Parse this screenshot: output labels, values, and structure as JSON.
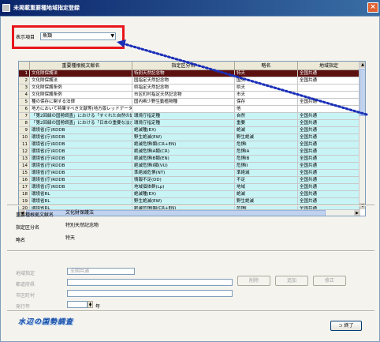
{
  "window": {
    "title": "未掲載重要種地域指定登録",
    "close_glyph": "×"
  },
  "filter": {
    "label": "表示項目",
    "value": "魚類",
    "arrow": "▼"
  },
  "grid": {
    "columns": [
      "",
      "重要種根拠文献名",
      "指定区分名",
      "略名",
      "地域指定"
    ],
    "rows": [
      {
        "n": "1",
        "doc": "文化財保護法",
        "cat": "特別天然記念物",
        "abbr": "特天",
        "region": "全国共通",
        "style": "selected"
      },
      {
        "n": "2",
        "doc": "文化財保護法",
        "cat": "国指定天然記念物",
        "abbr": "国天",
        "region": "全国共通",
        "style": "white"
      },
      {
        "n": "3",
        "doc": "文化財保護条例",
        "cat": "県指定天然記念物",
        "abbr": "県天",
        "region": "",
        "style": "white"
      },
      {
        "n": "4",
        "doc": "文化財保護条例",
        "cat": "市区町村指定天然記念物",
        "abbr": "市天",
        "region": "",
        "style": "white"
      },
      {
        "n": "5",
        "doc": "種の保存に関する法律",
        "cat": "国内希少野生動植物種",
        "abbr": "保存",
        "region": "全国共通",
        "style": "white"
      },
      {
        "n": "6",
        "doc": "地方において特筆すべき文献等(地方版レッドデータブック)",
        "cat": "",
        "abbr": "他",
        "region": "",
        "style": "white"
      },
      {
        "n": "7",
        "doc": "「第2回緑の国勢調査」における「すぐれた自然の調査」の対象",
        "cat": "環境庁指定種",
        "abbr": "自然",
        "region": "全国共通",
        "style": "cyan"
      },
      {
        "n": "8",
        "doc": "「第2回緑の国勢調査」における「日本の重要な淡水魚類」",
        "cat": "環境庁指定種",
        "abbr": "重要",
        "region": "全国共通",
        "style": "cyan"
      },
      {
        "n": "9",
        "doc": "環境省(庁)RDDB",
        "cat": "絶滅種(EX)",
        "abbr": "絶滅",
        "region": "全国共通",
        "style": "cyan"
      },
      {
        "n": "10",
        "doc": "環境省(庁)RDDB",
        "cat": "野生絶滅(EW)",
        "abbr": "野生絶滅",
        "region": "全国共通",
        "style": "cyan"
      },
      {
        "n": "11",
        "doc": "環境省(庁)RDDB",
        "cat": "絶滅危惧I類(CR+EN)",
        "abbr": "危惧I",
        "region": "全国共通",
        "style": "cyan"
      },
      {
        "n": "12",
        "doc": "環境省(庁)RDDB",
        "cat": "絶滅危惧IA類(CR)",
        "abbr": "危惧IA",
        "region": "全国共通",
        "style": "cyan"
      },
      {
        "n": "13",
        "doc": "環境省(庁)RDDB",
        "cat": "絶滅危惧IB類(EN)",
        "abbr": "危惧IB",
        "region": "全国共通",
        "style": "cyan"
      },
      {
        "n": "14",
        "doc": "環境省(庁)RDDB",
        "cat": "絶滅危惧II類(VU)",
        "abbr": "危惧II",
        "region": "全国共通",
        "style": "cyan"
      },
      {
        "n": "15",
        "doc": "環境省(庁)RDDB",
        "cat": "準絶滅危惧(NT)",
        "abbr": "準絶滅",
        "region": "全国共通",
        "style": "cyan"
      },
      {
        "n": "16",
        "doc": "環境省(庁)RDDB",
        "cat": "情報不足(DD)",
        "abbr": "不足",
        "region": "全国共通",
        "style": "cyan"
      },
      {
        "n": "17",
        "doc": "環境省(庁)RDDB",
        "cat": "地域個体群(Lp)",
        "abbr": "地域",
        "region": "全国共通",
        "style": "cyan"
      },
      {
        "n": "18",
        "doc": "環境省RL",
        "cat": "絶滅種(EX)",
        "abbr": "絶滅",
        "region": "全国共通",
        "style": "cyan"
      },
      {
        "n": "19",
        "doc": "環境省RL",
        "cat": "野生絶滅(EW)",
        "abbr": "野生絶滅",
        "region": "全国共通",
        "style": "cyan"
      },
      {
        "n": "20",
        "doc": "環境省RL",
        "cat": "絶滅危惧I類(CR+EN)",
        "abbr": "危惧I",
        "region": "全国共通",
        "style": "cyan"
      }
    ]
  },
  "detail": {
    "doc_label": "重要種根拠文献名",
    "doc_value": "文化財保護法",
    "cat_label": "指定区分名",
    "cat_value": "特別天然記念物",
    "abbr_label": "略名",
    "abbr_value": "特天"
  },
  "edit": {
    "region_label": "地域指定",
    "region_value": "全国共通",
    "prefecture_label": "都道府県",
    "city_label": "市区町村",
    "year_label": "発行年",
    "year_unit": "年"
  },
  "buttons": {
    "delete": "削除",
    "add": "追加",
    "update": "修正",
    "close": "終了",
    "close_glyph": "⊃"
  },
  "logo": "水辺の国勢調査",
  "colors": {
    "selected_row": "#5c1010",
    "cyan_row": "#c8f4f6",
    "highlight": "#e8161b",
    "pointer": "#1a2fb8"
  }
}
